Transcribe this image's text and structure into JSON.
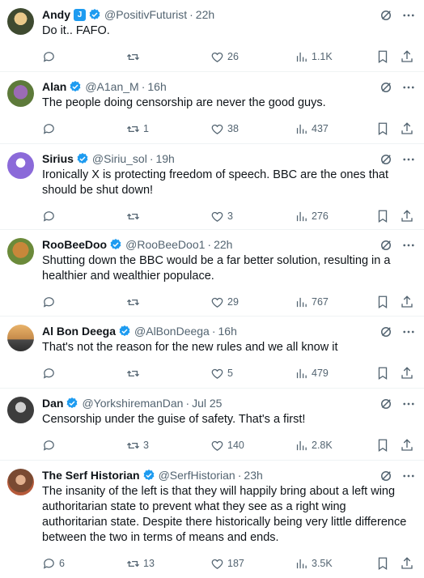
{
  "tweets": [
    {
      "name": "Andy",
      "badge_extra": "J",
      "handle": "@PositivFuturist",
      "time": "22h",
      "text": "Do it..  FAFO.",
      "replies": "",
      "retweets": "",
      "likes": "26",
      "views": "1.1K",
      "avatar_color": "#4b5b3a"
    },
    {
      "name": "Alan",
      "handle": "@A1an_M",
      "time": "16h",
      "text": "The people doing censorship are never the good guys.",
      "replies": "",
      "retweets": "1",
      "likes": "38",
      "views": "437",
      "avatar_color": "#7a5a8a"
    },
    {
      "name": "Sirius",
      "handle": "@Siriu_sol",
      "time": "19h",
      "text": "Ironically X is protecting freedom of speech. BBC are the ones that should be shut down!",
      "replies": "",
      "retweets": "",
      "likes": "3",
      "views": "276",
      "avatar_color": "#8b6ad9"
    },
    {
      "name": "RooBeeDoo",
      "handle": "@RooBeeDoo1",
      "time": "22h",
      "text": "Shutting down the BBC would be a far better solution, resulting in a healthier and wealthier populace.",
      "replies": "",
      "retweets": "",
      "likes": "29",
      "views": "767",
      "avatar_color": "#a0682a"
    },
    {
      "name": "Al Bon Deega",
      "handle": "@AlBonDeega",
      "time": "16h",
      "text": "That's not the reason for the new rules and we all know it",
      "replies": "",
      "retweets": "",
      "likes": "5",
      "views": "479",
      "avatar_color": "#c79a5a"
    },
    {
      "name": "Dan",
      "handle": "@YorkshiremanDan",
      "time": "Jul 25",
      "text": "Censorship under the guise of safety. That's a first!",
      "replies": "",
      "retweets": "3",
      "likes": "140",
      "views": "2.8K",
      "avatar_color": "#555555"
    },
    {
      "name": "The Serf Historian",
      "handle": "@SerfHistorian",
      "time": "23h",
      "text": "The insanity of the left is that they will happily bring about a left wing authoritarian state to prevent what they see as a right wing authoritarian state. Despite there historically being very little difference between the two in terms of means and ends.",
      "replies": "6",
      "retweets": "13",
      "likes": "187",
      "views": "3.5K",
      "avatar_color": "#8a5a44"
    }
  ],
  "colors": {
    "verified": "#1d9bf0",
    "muted": "#536471",
    "text": "#0f1419",
    "divider": "#eff3f4"
  },
  "icons": [
    "grok-icon",
    "more-icon",
    "reply-icon",
    "retweet-icon",
    "like-icon",
    "views-icon",
    "bookmark-icon",
    "share-icon",
    "verified-badge-icon"
  ]
}
